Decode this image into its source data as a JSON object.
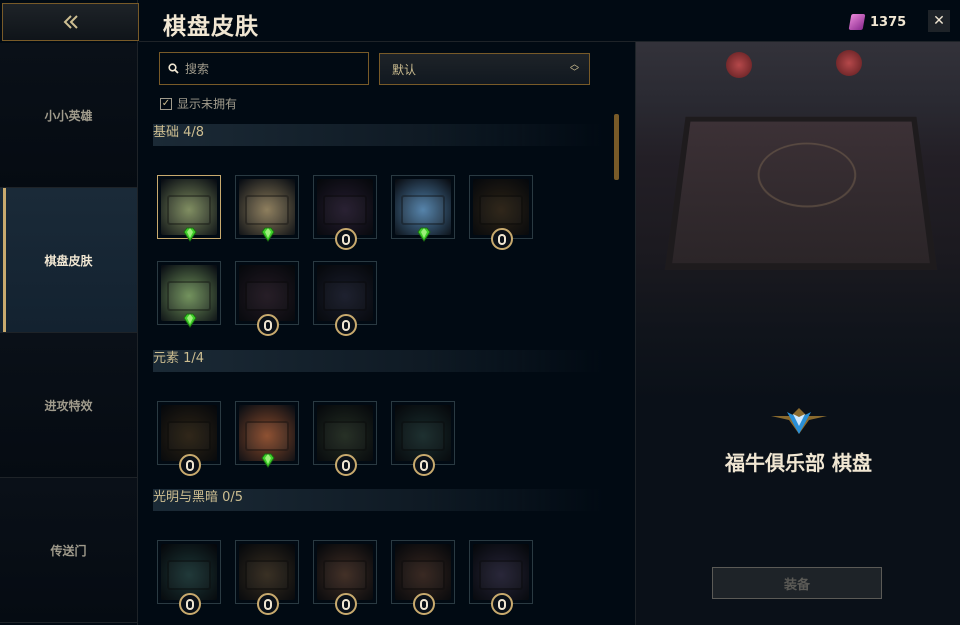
{
  "header": {
    "title": "棋盘皮肤",
    "currency_amount": "1375",
    "currency_icon": "orange-essence-gem-icon",
    "close_icon": "close-icon"
  },
  "sidebar": {
    "back_icon": "back-arrow-icon",
    "items": [
      {
        "label": "小小英雄",
        "active": false
      },
      {
        "label": "棋盘皮肤",
        "active": true
      },
      {
        "label": "进攻特效",
        "active": false
      },
      {
        "label": "传送门",
        "active": false
      }
    ]
  },
  "filters": {
    "search_placeholder": "搜索",
    "sort_selected": "默认",
    "show_unowned_label": "显示未拥有",
    "show_unowned_checked": true
  },
  "sections": [
    {
      "title": "基础 4/8",
      "tiles": [
        {
          "state": "owned-selected",
          "color": "#7c8a5c"
        },
        {
          "state": "owned",
          "color": "#8a7a58"
        },
        {
          "state": "locked",
          "color": "#3e2f4e"
        },
        {
          "state": "owned",
          "color": "#4f7fa8"
        },
        {
          "state": "locked",
          "color": "#4a3a24"
        },
        {
          "state": "owned",
          "color": "#6e8f58"
        },
        {
          "state": "locked",
          "color": "#3a2a3a"
        },
        {
          "state": "locked",
          "color": "#2a2f48"
        }
      ]
    },
    {
      "title": "元素 1/4",
      "tiles": [
        {
          "state": "locked",
          "color": "#4a3a22"
        },
        {
          "state": "owned",
          "color": "#8a4a2a"
        },
        {
          "state": "locked",
          "color": "#3a4a38"
        },
        {
          "state": "locked",
          "color": "#2a4a4a"
        }
      ]
    },
    {
      "title": "光明与黑暗 0/5",
      "tiles": [
        {
          "state": "locked",
          "color": "#2e5a5a"
        },
        {
          "state": "locked",
          "color": "#5a4a34"
        },
        {
          "state": "locked",
          "color": "#6a4a3a"
        },
        {
          "state": "locked",
          "color": "#5a3e32"
        },
        {
          "state": "locked",
          "color": "#3e3a5a"
        }
      ]
    }
  ],
  "preview": {
    "skin_name": "福牛俱乐部 棋盘",
    "emblem_icon": "rarity-emblem-icon",
    "equip_label": "装备",
    "equip_enabled": false
  }
}
